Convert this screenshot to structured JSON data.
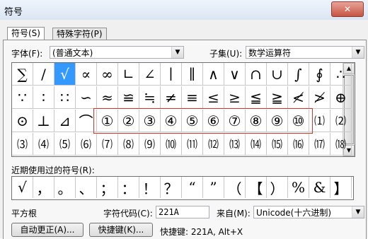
{
  "window": {
    "title": "符号",
    "close": "✕"
  },
  "tabs": [
    {
      "label": "符号(S)",
      "active": true
    },
    {
      "label": "特殊字符(P)",
      "active": false
    }
  ],
  "font": {
    "label": "字体(F):",
    "value": "(普通文本)"
  },
  "subset": {
    "label": "子集(U):",
    "value": "数学运算符"
  },
  "symbols": [
    [
      "∑",
      "/",
      "√",
      "∝",
      "∞",
      "∟",
      "∠",
      "∣",
      "∥",
      "∧",
      "∨",
      "∩",
      "∪",
      "∫",
      "∮",
      "∴"
    ],
    [
      "∵",
      "∶",
      "∷",
      "∽",
      "≈",
      "≌",
      "≒",
      "≠",
      "≡",
      "≤",
      "≥",
      "≦",
      "≧",
      "≮",
      "≯",
      "⊕"
    ],
    [
      "⊙",
      "⊥",
      "⊿",
      "⌒",
      "①",
      "②",
      "③",
      "④",
      "⑤",
      "⑥",
      "⑦",
      "⑧",
      "⑨",
      "⑩",
      "⑴",
      "⑵"
    ],
    [
      "⑶",
      "⑷",
      "⑸",
      "⑹",
      "⑺",
      "⑻",
      "⑼",
      "⑽",
      "⑾",
      "⑿",
      "⒀",
      "⒁",
      "⒂",
      "⒃",
      "⒄",
      "⒅"
    ]
  ],
  "recent": {
    "label": "近期使用过的符号(R):",
    "items": [
      "√",
      "，",
      "。",
      "、",
      "；",
      "：",
      "！",
      "？",
      "“",
      "”",
      "（",
      "【",
      "）",
      "%",
      "&",
      "】"
    ]
  },
  "char_name": "平方根",
  "char_code": {
    "label": "字符代码(C):",
    "value": "221A"
  },
  "from": {
    "label": "来自(M):",
    "value": "Unicode(十六进制)"
  },
  "buttons": {
    "autocorrect": "自动更正(A)...",
    "shortcut": "快捷键(K)..."
  },
  "shortcut_text": "快捷键: 221A, Alt+X",
  "colors": {
    "selected": "#3399ff",
    "highlight": "#d9322b"
  }
}
